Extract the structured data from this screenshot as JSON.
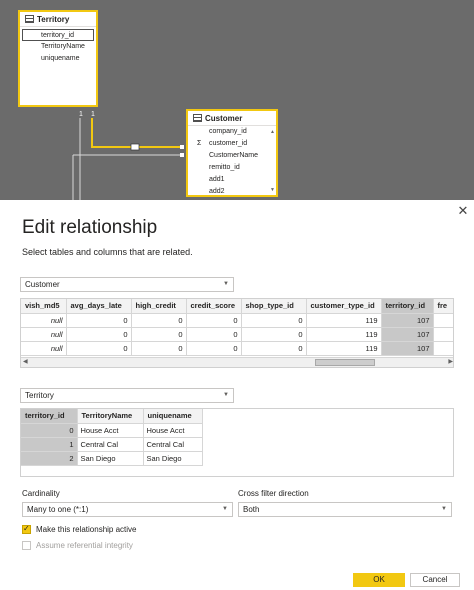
{
  "diagram": {
    "territory_table": {
      "title": "Territory",
      "fields": [
        "territory_id",
        "TerritoryName",
        "uniquename"
      ]
    },
    "customer_table": {
      "title": "Customer",
      "fields": [
        "company_id",
        "customer_id",
        "CustomerName",
        "remitto_id",
        "add1",
        "add2"
      ]
    },
    "connector_labels": {
      "one_a": "1",
      "one_b": "1"
    }
  },
  "dialog": {
    "title": "Edit relationship",
    "subtitle": "Select tables and columns that are related.",
    "close_icon": "close-icon",
    "table1": {
      "selected": "Customer",
      "columns": [
        "vish_md5",
        "avg_days_late",
        "high_credit",
        "credit_score",
        "shop_type_id",
        "customer_type_id",
        "territory_id",
        "fre"
      ],
      "rows": [
        [
          "null",
          "0",
          "0",
          "0",
          "0",
          "119",
          "107",
          ""
        ],
        [
          "null",
          "0",
          "0",
          "0",
          "0",
          "119",
          "107",
          ""
        ],
        [
          "null",
          "0",
          "0",
          "0",
          "0",
          "119",
          "107",
          ""
        ]
      ],
      "selected_column": "territory_id"
    },
    "table2": {
      "selected": "Territory",
      "columns": [
        "territory_id",
        "TerritoryName",
        "uniquename"
      ],
      "rows": [
        [
          "0",
          "House Acct",
          "House Acct"
        ],
        [
          "1",
          "Central Cal",
          "Central Cal"
        ],
        [
          "2",
          "San Diego",
          "San Diego"
        ]
      ],
      "selected_column": "territory_id"
    },
    "cardinality": {
      "label": "Cardinality",
      "value": "Many to one (*:1)"
    },
    "cross_filter": {
      "label": "Cross filter direction",
      "value": "Both"
    },
    "make_active": {
      "label": "Make this relationship active",
      "checked": true
    },
    "referential_integrity": {
      "label": "Assume referential integrity",
      "checked": false,
      "disabled": true
    },
    "ok_label": "OK",
    "cancel_label": "Cancel"
  },
  "colors": {
    "accent": "#f2c811",
    "canvas": "#6b6b6b",
    "selected_column": "#c8c8c8"
  }
}
